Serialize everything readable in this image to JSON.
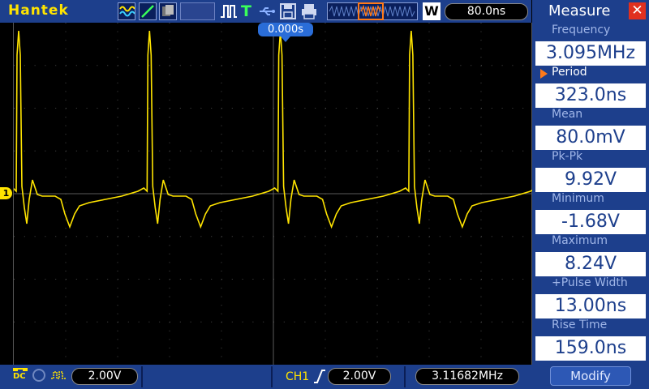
{
  "header": {
    "brand": "Hantek",
    "timebase": "80.0ns",
    "memory_depth_label": "W",
    "trigger_mode_label": "T"
  },
  "screen": {
    "trigger_position": "0.000s",
    "channel_marker": "1"
  },
  "measure_panel": {
    "title": "Measure",
    "items": [
      {
        "label": "Frequency",
        "value": "3.095MHz",
        "selected": false
      },
      {
        "label": "Period",
        "value": "323.0ns",
        "selected": true
      },
      {
        "label": "Mean",
        "value": "80.0mV",
        "selected": false
      },
      {
        "label": "Pk-Pk",
        "value": "9.92V",
        "selected": false
      },
      {
        "label": "Minimum",
        "value": "-1.68V",
        "selected": false
      },
      {
        "label": "Maximum",
        "value": "8.24V",
        "selected": false
      },
      {
        "label": "+Pulse Width",
        "value": "13.00ns",
        "selected": false
      },
      {
        "label": "Rise Time",
        "value": "159.0ns",
        "selected": false
      }
    ],
    "modify_label": "Modify"
  },
  "footer": {
    "coupling": "DC",
    "ch1_scale": "2.00V",
    "trigger_channel": "CH1",
    "trigger_level": "2.00V",
    "frequency_counter": "3.11682MHz"
  },
  "colors": {
    "trace": "#ffe400",
    "ui_blue": "#1d3f8c",
    "accent_orange": "#ff7a1a",
    "close_red": "#e0301e"
  }
}
